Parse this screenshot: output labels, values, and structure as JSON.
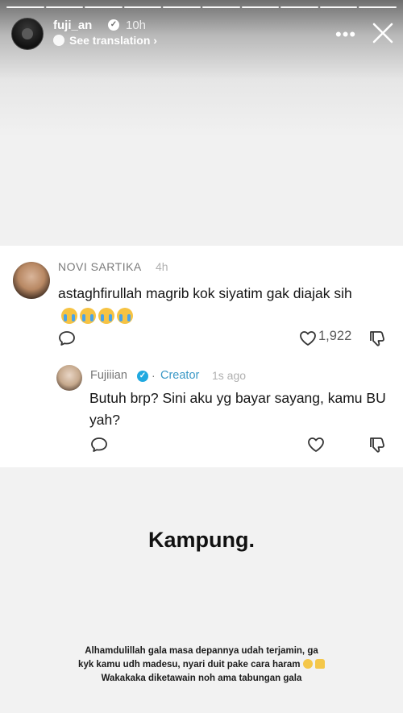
{
  "story": {
    "username": "fuji_an",
    "verified_glyph": "✓",
    "time": "10h",
    "translation_label": "See translation ›",
    "more_label": "•••",
    "progress_segments": 10,
    "header_icons": [
      "globe-icon",
      "more-icon",
      "close-icon"
    ]
  },
  "comment": {
    "author": "NOVI SARTIKA",
    "time": "4h",
    "text": "astaghfirullah magrib kok siyatim gak diajak sih",
    "emoji_count": 4,
    "emoji_name": "loudly-crying-face-emoji",
    "likes": "1,922",
    "actions": [
      "reply-icon",
      "heart-icon",
      "dislike-icon"
    ]
  },
  "reply": {
    "author": "Fujiiian",
    "verified_glyph": "✓",
    "separator": "·",
    "badge": "Creator",
    "time": "1s ago",
    "text": "Butuh brp? Sini aku yg bayar sayang, kamu BU yah?",
    "actions": [
      "reply-icon",
      "heart-icon",
      "dislike-icon"
    ]
  },
  "caption": {
    "title": "Kampung.",
    "line1": "Alhamdulillah gala masa depannya udah terjamin, ga",
    "line2": "kyk kamu udh madesu, nyari duit pake cara haram",
    "line3": "Wakakaka diketawain noh ama tabungan gala",
    "line2_emojis": [
      "smiling-face-emoji",
      "thumbs-up-emoji"
    ]
  },
  "colors": {
    "creator": "#3a98c6",
    "verified": "#20a9e0",
    "text": "#161616",
    "muted": "#7a7a7a"
  }
}
